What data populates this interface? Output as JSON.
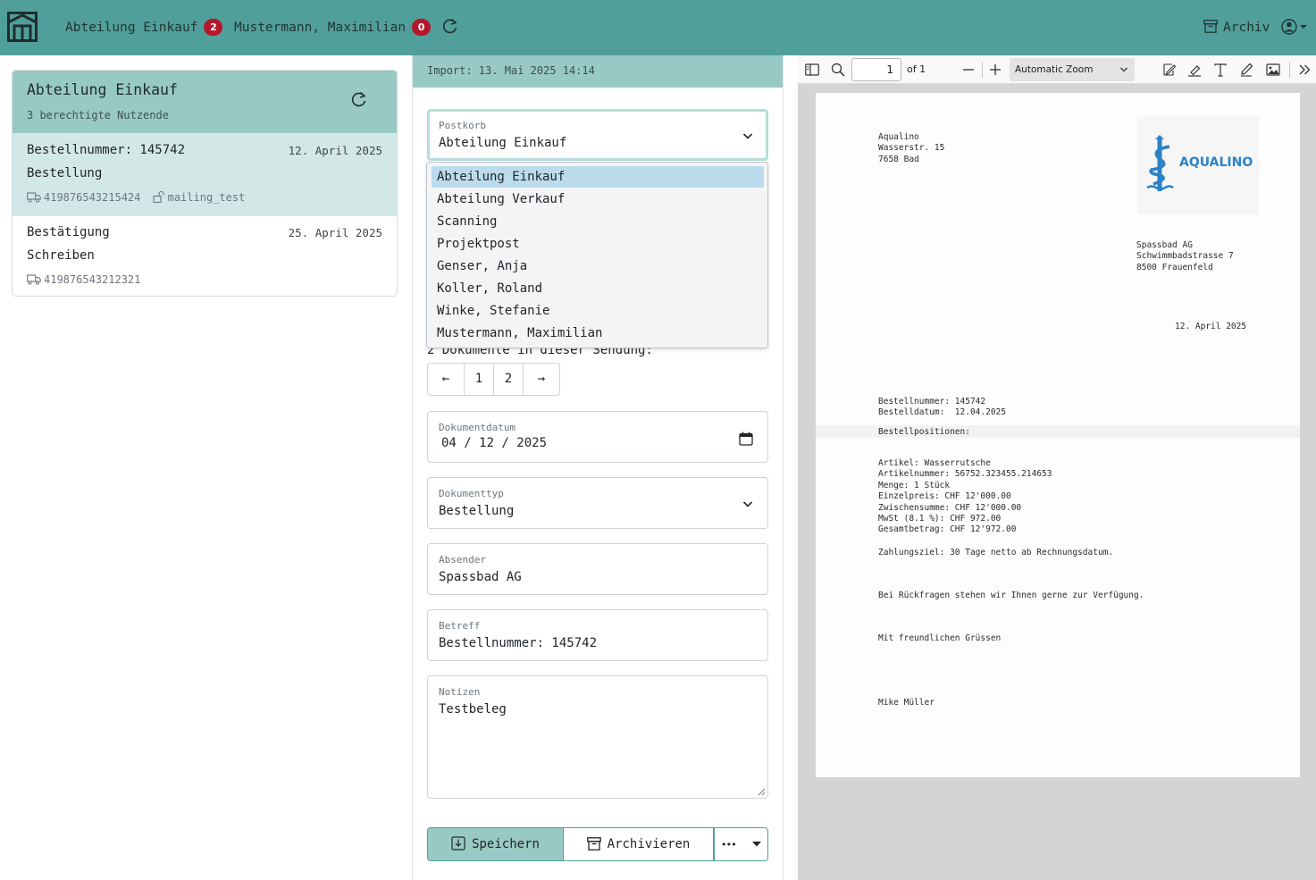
{
  "topbar": {
    "mailbox_name": "Abteilung Einkauf",
    "mailbox_count": "2",
    "user_name": "Mustermann, Maximilian",
    "user_count": "0",
    "archive_label": "Archiv"
  },
  "left": {
    "title": "Abteilung Einkauf",
    "subtitle": "3 berechtigte Nutzende",
    "items": [
      {
        "title": "Bestellnummer: 145742",
        "date": "12. April 2025",
        "type": "Bestellung",
        "tracking": "419876543215424",
        "user": "mailing_test"
      },
      {
        "title": "Bestätigung",
        "date": "25. April 2025",
        "type": "Schreiben",
        "tracking": "419876543212321"
      }
    ]
  },
  "form": {
    "import_text": "Import: 13. Mai 2025 14:14",
    "postkorb_label": "Postkorb",
    "postkorb_value": "Abteilung Einkauf",
    "postkorb_options": [
      "Abteilung Einkauf",
      "Abteilung Verkauf",
      "Scanning",
      "Projektpost",
      "Genser, Anja",
      "Koller, Roland",
      "Winke, Stefanie",
      "Mustermann, Maximilian"
    ],
    "docs_text": "2 Dokumente in dieser Sendung:",
    "pager": {
      "prev": "←",
      "p1": "1",
      "p2": "2",
      "next": "→"
    },
    "date_label": "Dokumentdatum",
    "date_value": "04 / 12 / 2025",
    "type_label": "Dokumenttyp",
    "type_value": "Bestellung",
    "sender_label": "Absender",
    "sender_value": "Spassbad AG",
    "subject_label": "Betreff",
    "subject_value": "Bestellnummer: 145742",
    "notes_label": "Notizen",
    "notes_value": "Testbeleg",
    "save_label": "Speichern",
    "archive_label": "Archivieren",
    "more_label": "•••"
  },
  "viewer": {
    "page_number": "1",
    "page_count": "of 1",
    "zoom": "Automatic Zoom",
    "doc": {
      "sender_address": "Aqualino\nWasserstr. 15\n7658 Bad",
      "logo_text": "AQUALINO",
      "recipient_address": "Spassbad AG\nSchwimmbadstrasse 7\n8500 Frauenfeld",
      "date": "12. April 2025",
      "order_info": "Bestellnummer: 145742\nBestelldatum:  12.04.2025",
      "positions_heading": "Bestellpositionen:",
      "positions": "Artikel: Wasserrutsche\nArtikelnummer: 56752.323455.214653\nMenge: 1 Stück\nEinzelpreis: CHF 12'000.00\nZwischensumme: CHF 12'000.00\nMwSt (8.1 %): CHF 972.00\nGesamtbetrag: CHF 12'972.00",
      "payment_terms": "Zahlungsziel: 30 Tage netto ab Rechnungsdatum.",
      "questions": "Bei Rückfragen stehen wir Ihnen gerne zur Verfügung.",
      "closing": "Mit freundlichen Grüssen",
      "signature": "Mike Müller"
    }
  },
  "colors": {
    "brand": "#519f9a",
    "brand_light": "#99c9c5",
    "badge": "#b4172b"
  }
}
